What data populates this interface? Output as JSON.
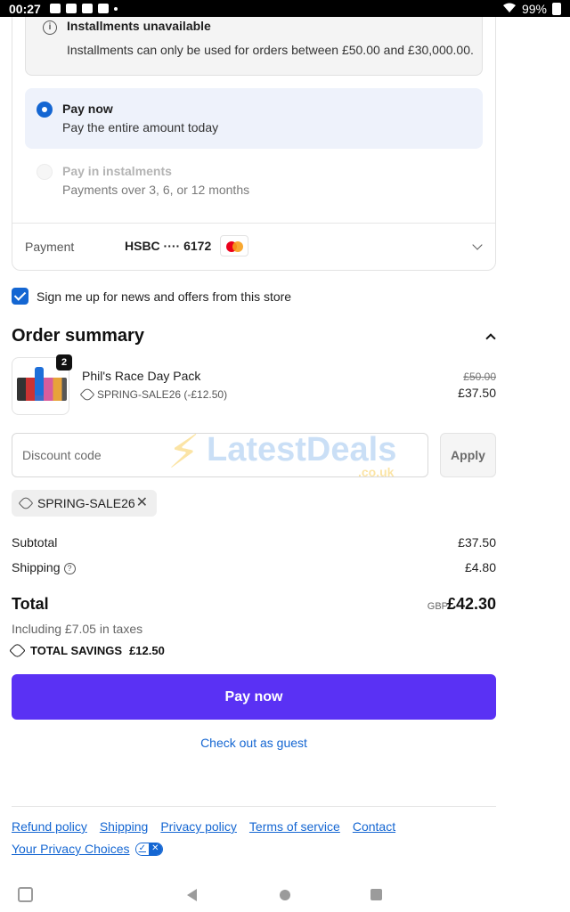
{
  "status_bar": {
    "time": "00:27",
    "battery": "99%"
  },
  "payment": {
    "info_title": "Installments unavailable",
    "info_text": "Installments can only be used for orders between £50.00 and £30,000.00.",
    "options": [
      {
        "title": "Pay now",
        "subtitle": "Pay the entire amount today",
        "selected": true
      },
      {
        "title": "Pay in instalments",
        "subtitle": "Payments over 3, 6, or 12 months",
        "selected": false,
        "disabled": true
      }
    ],
    "method_label": "Payment",
    "card_text": "HSBC ···· 6172"
  },
  "newsletter": {
    "label": "Sign me up for news and offers from this store",
    "checked": true
  },
  "order_summary": {
    "title": "Order summary",
    "item": {
      "name": "Phil's Race Day Pack",
      "quantity": "2",
      "discount": "SPRING-SALE26 (-£12.50)",
      "original_price": "£50.00",
      "price": "£37.50"
    },
    "discount_placeholder": "Discount code",
    "apply_label": "Apply",
    "applied_code": "SPRING-SALE26",
    "subtotal_label": "Subtotal",
    "subtotal": "£37.50",
    "shipping_label": "Shipping",
    "shipping": "£4.80",
    "total_label": "Total",
    "currency": "GBP",
    "total": "£42.30",
    "tax_note": "Including £7.05 in taxes",
    "savings_label": "TOTAL SAVINGS",
    "savings": "£12.50"
  },
  "watermark": {
    "text": "LatestDeals",
    "sub": ".co.uk"
  },
  "actions": {
    "pay_now": "Pay now",
    "guest": "Check out as guest"
  },
  "footer": {
    "links": [
      "Refund policy",
      "Shipping",
      "Privacy policy",
      "Terms of service",
      "Contact"
    ],
    "privacy_choices": "Your Privacy Choices"
  },
  "colors": {
    "accent": "#5a31f4",
    "link": "#1466d2"
  }
}
